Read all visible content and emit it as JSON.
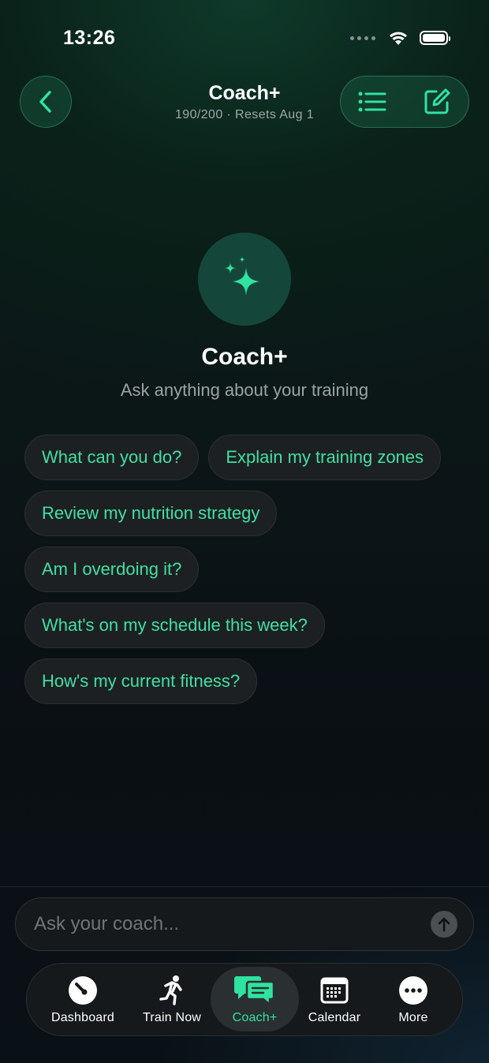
{
  "status_bar": {
    "time": "13:26"
  },
  "header": {
    "title": "Coach+",
    "subtitle": "190/200 · Resets Aug 1"
  },
  "hero": {
    "title": "Coach+",
    "subtitle": "Ask anything about your training"
  },
  "suggestions": [
    "What can you do?",
    "Explain my training zones",
    "Review my nutrition strategy",
    "Am I overdoing it?",
    "What's on my schedule this week?",
    "How's my current fitness?"
  ],
  "input": {
    "placeholder": "Ask your coach..."
  },
  "tabs": [
    {
      "label": "Dashboard",
      "icon": "gauge-icon"
    },
    {
      "label": "Train Now",
      "icon": "runner-icon"
    },
    {
      "label": "Coach+",
      "icon": "chat-bubbles-icon",
      "active": true
    },
    {
      "label": "Calendar",
      "icon": "calendar-icon"
    },
    {
      "label": "More",
      "icon": "more-dots-icon"
    }
  ],
  "colors": {
    "accent": "#2fe3a0",
    "chip_text": "#3fe0a4",
    "background": "#0b1517"
  }
}
